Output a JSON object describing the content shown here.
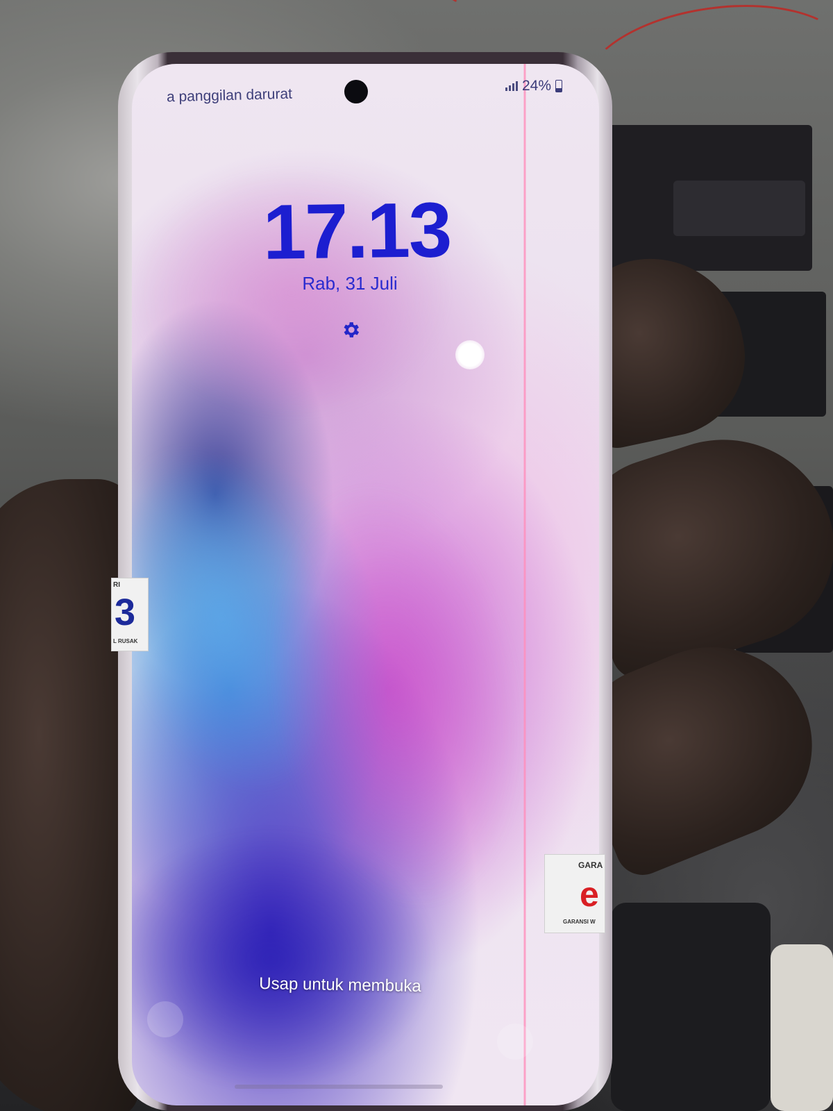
{
  "status_bar": {
    "emergency_call_text": "a panggilan darurat",
    "battery_percent": "24%"
  },
  "lock_screen": {
    "time": "17.13",
    "date": "Rab, 31 Juli",
    "swipe_hint": "Usap untuk membuka"
  },
  "stickers": {
    "left": {
      "top_text": "RI",
      "big_text": "3",
      "bottom_text": "L RUSAK"
    },
    "right": {
      "top_text": "GARA",
      "big_text": "e",
      "bottom_text": "GARANSI W"
    }
  },
  "colors": {
    "clock": "#1c1ed0",
    "date": "#2a2bcf",
    "pink_line_artifact": "#ff8ebc"
  },
  "icons": [
    "signal-icon",
    "battery-icon",
    "settings-gear-icon",
    "phone-icon",
    "camera-icon"
  ]
}
